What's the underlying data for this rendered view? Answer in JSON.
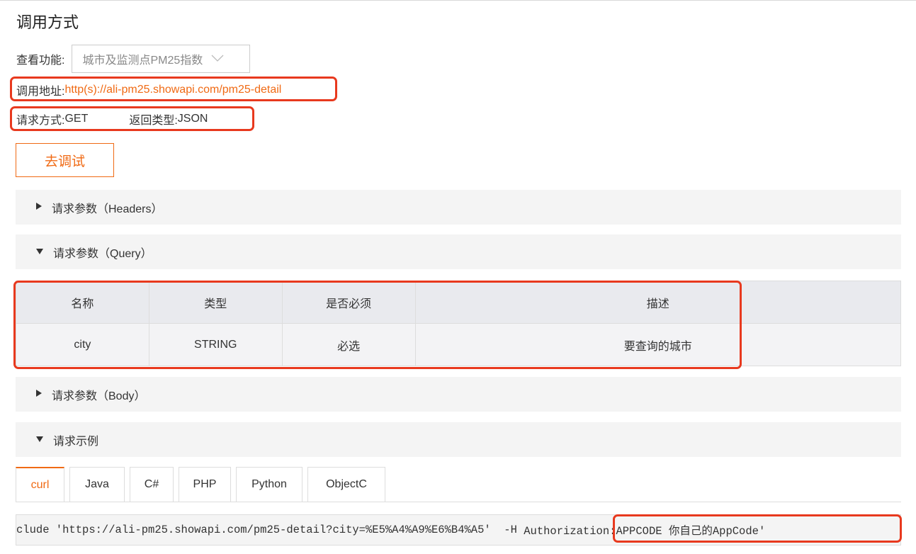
{
  "title": "调用方式",
  "function": {
    "label": "查看功能:",
    "selected": "城市及监测点PM25指数",
    "chevron": "chevron-down-icon"
  },
  "address": {
    "label": "调用地址:",
    "url": "http(s)://ali-pm25.showapi.com/pm25-detail"
  },
  "method": {
    "label": "请求方式:",
    "value": "GET",
    "return_label": "返回类型:",
    "return_value": "JSON"
  },
  "debug_button": "去调试",
  "sections": {
    "headers": "请求参数（Headers）",
    "query": "请求参数（Query）",
    "body": "请求参数（Body）",
    "example": "请求示例"
  },
  "icons": {
    "collapsed": "triangle-right-icon",
    "expanded": "triangle-down-icon"
  },
  "table": {
    "headers": [
      "名称",
      "类型",
      "是否必须",
      "描述"
    ],
    "rows": [
      [
        "city",
        "STRING",
        "必选",
        "要查询的城市"
      ]
    ]
  },
  "tabs": [
    "curl",
    "Java",
    "C#",
    "PHP",
    "Python",
    "ObjectC"
  ],
  "code": {
    "main": "clude 'https://ali-pm25.showapi.com/pm25-detail?city=%E5%A4%A9%E6%B4%A5'  -H ",
    "auth": "Authorization:APPCODE 你自己的AppCode'"
  },
  "colors": {
    "accent": "#f06a14",
    "highlight": "#e8391e"
  }
}
